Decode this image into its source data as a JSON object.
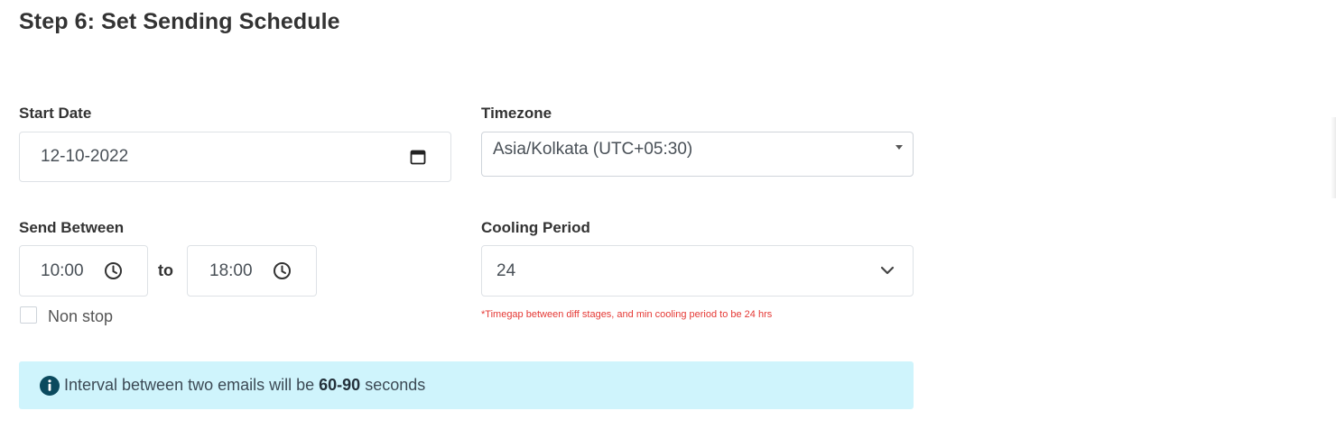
{
  "step": {
    "title": "Step 6: Set Sending Schedule"
  },
  "start_date": {
    "label": "Start Date",
    "value": "12-10-2022",
    "icon": "calendar-icon"
  },
  "timezone": {
    "label": "Timezone",
    "value": "Asia/Kolkata (UTC+05:30)",
    "icon": "caret-down-icon"
  },
  "send_between": {
    "label": "Send Between",
    "from": "10:00",
    "to_label": "to",
    "to": "18:00",
    "icon": "clock-icon"
  },
  "non_stop": {
    "label": "Non stop",
    "checked": false
  },
  "cooling_period": {
    "label": "Cooling Period",
    "value": "24",
    "icon": "chevron-down-icon",
    "hint": "*Timegap between diff stages, and min cooling period to be 24 hrs",
    "hint_color": "#e53935"
  },
  "interval_alert": {
    "icon": "info-icon",
    "prefix": "Interval between two emails will be",
    "range": "60-90",
    "suffix": "seconds",
    "background": "#cff4fc"
  }
}
